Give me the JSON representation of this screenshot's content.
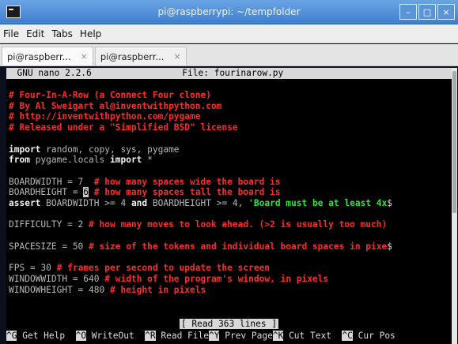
{
  "window": {
    "title": "pi@raspberrypi: ~/tempfolder"
  },
  "menu": {
    "file": "File",
    "edit": "Edit",
    "tabs": "Tabs",
    "help": "Help"
  },
  "tabs": [
    {
      "label": "pi@raspberr...",
      "close": "×"
    },
    {
      "label": "pi@raspberr...",
      "close": "×"
    }
  ],
  "nano": {
    "version": "GNU nano 2.2.6",
    "file_label": "File: fourinarow.py",
    "lines": {
      "c1": "# Four-In-A-Row (a Connect Four clone)",
      "c2": "# By Al Sweigart al@inventwithpython.com",
      "c3": "# http://inventwithpython.com/pygame",
      "c4": "# Released under a \"Simplified BSD\" license",
      "import_kw": "import",
      "import_rest": " random, copy, sys, pygame",
      "from_kw": "from",
      "from_mod": " pygame.locals ",
      "from_import": "import",
      "from_star": " *",
      "bw_code": "BOARDWIDTH = 7  ",
      "bw_cmt": "# how many spaces wide the board is",
      "bh_code": "BOARDHEIGHT = ",
      "bh_cursor": "6",
      "bh_cmt": " # how many spaces tall the board is",
      "assert_kw": "assert",
      "assert_mid": " BOARDWIDTH >= 4 ",
      "and_kw": "and",
      "assert_mid2": " BOARDHEIGHT >= 4, ",
      "assert_str": "'Board must be at least 4x",
      "overflow": "$",
      "diff_code": "DIFFICULTY = 2 ",
      "diff_cmt": "# how many moves to look ahead. (>2 is usually too much)",
      "space_code": "SPACESIZE = 50 ",
      "space_cmt": "# size of the tokens and individual board spaces in pixe",
      "fps_code": "FPS = 30 ",
      "fps_cmt": "# frames per second to update the screen",
      "ww_code": "WINDOWWIDTH = 640 ",
      "ww_cmt": "# width of the program's window, in pixels",
      "wh_code": "WINDOWHEIGHT = 480 ",
      "wh_cmt": "# height in pixels"
    },
    "status": "[ Read 363 lines ]",
    "shortcuts": [
      {
        "key": "^G",
        "label": " Get Help  "
      },
      {
        "key": "^O",
        "label": " WriteOut  "
      },
      {
        "key": "^R",
        "label": " Read File"
      },
      {
        "key": "^Y",
        "label": " Prev Page"
      },
      {
        "key": "^K",
        "label": " Cut Text  "
      },
      {
        "key": "^C",
        "label": " Cur Pos"
      }
    ]
  },
  "colors": {
    "comment": "#ff2a2a",
    "keyword": "#f2f2f2",
    "string": "#33e23a",
    "titlebar": "#4f8fd8"
  }
}
